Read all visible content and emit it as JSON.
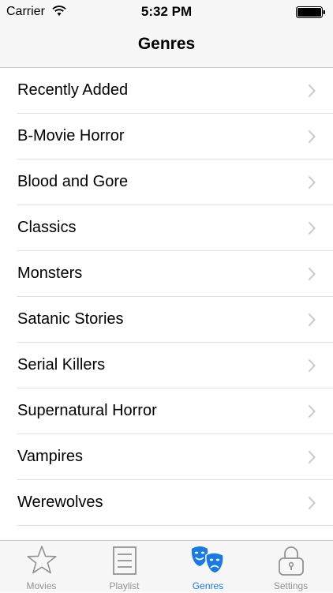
{
  "status": {
    "carrier": "Carrier",
    "time": "5:32 PM"
  },
  "nav": {
    "title": "Genres"
  },
  "genres": [
    "Recently Added",
    "B-Movie Horror",
    "Blood and Gore",
    "Classics",
    "Monsters",
    "Satanic Stories",
    "Serial Killers",
    "Supernatural Horror",
    "Vampires",
    "Werewolves"
  ],
  "tabs": [
    {
      "label": "Movies",
      "icon": "star-icon"
    },
    {
      "label": "Playlist",
      "icon": "list-icon"
    },
    {
      "label": "Genres",
      "icon": "theater-masks-icon",
      "active": true
    },
    {
      "label": "Settings",
      "icon": "lock-icon"
    }
  ],
  "colors": {
    "accent": "#1a7ae4",
    "inactive": "#929292",
    "bar": "#f7f7f7"
  }
}
